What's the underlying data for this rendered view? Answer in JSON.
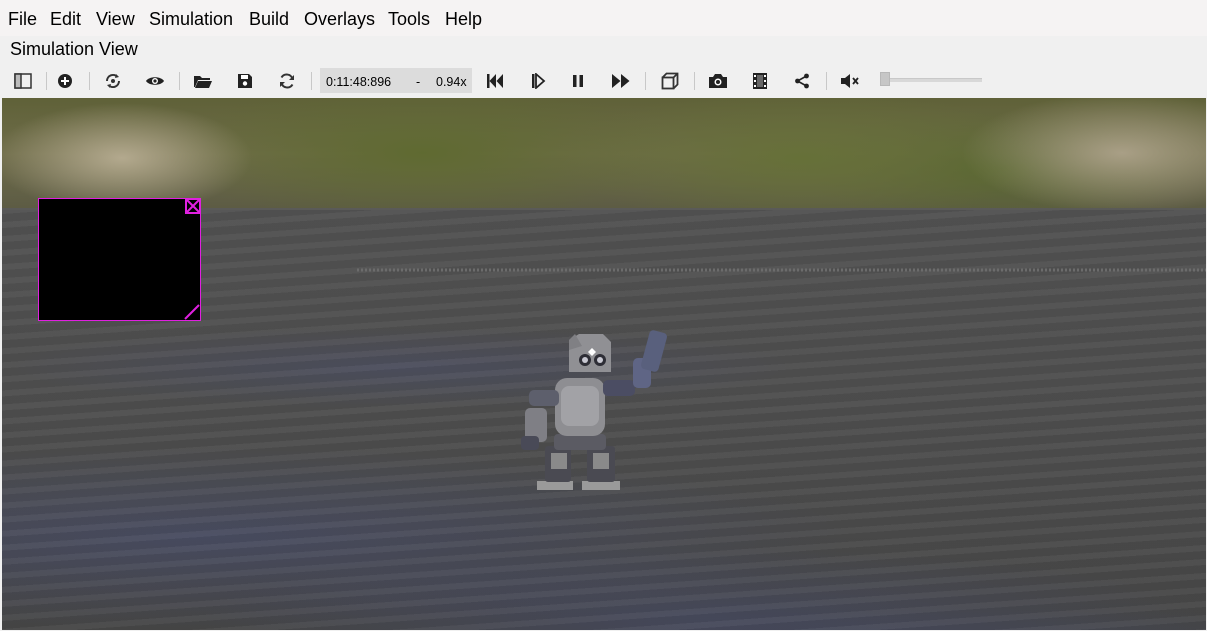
{
  "menu": [
    "File",
    "Edit",
    "View",
    "Simulation",
    "Build",
    "Overlays",
    "Tools",
    "Help"
  ],
  "view_title": "Simulation View",
  "toolbar": {
    "buttons": [
      "toggle-panel",
      "add",
      "reset-viewpoint",
      "show-hide",
      "open-world",
      "save-world",
      "reload-world",
      "reset-simulation",
      "step",
      "pause",
      "fast-forward",
      "perspective",
      "screenshot",
      "record-movie",
      "share",
      "mute"
    ],
    "time": "0:11:48:896",
    "time_sep": "-",
    "speed": "0.94x",
    "volume": 0
  },
  "colors": {
    "overlay_border": "#e020e0",
    "menubar_bg": "#f5f3f3"
  }
}
